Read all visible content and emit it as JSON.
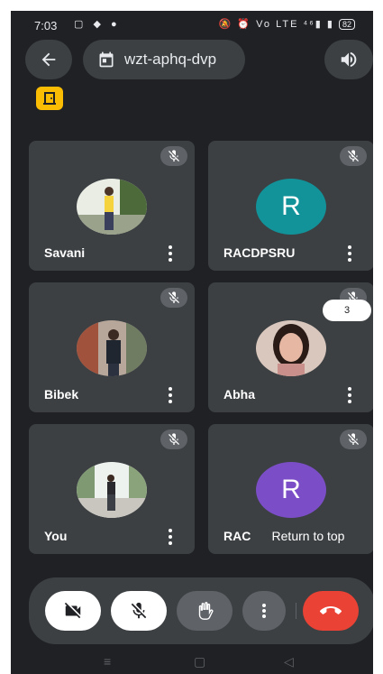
{
  "status_bar": {
    "time": "7:03",
    "left_icons": "▢ ◆ ●",
    "right_icons": "🔕 ⏰ Vo LTE ⁴⁶▮ ▮",
    "battery": "82"
  },
  "header": {
    "back_icon": "arrow-back-icon",
    "meeting_code": "wzt-aphq-dvp",
    "calendar_icon": "calendar-icon",
    "speaker_icon": "speaker-icon",
    "host_badge_icon": "door-icon",
    "colors": {
      "host_badge": "#fbbc04"
    }
  },
  "participants": [
    {
      "name": "Savani",
      "avatar": "photo",
      "muted": true
    },
    {
      "name": "RACDPSRU",
      "avatar": "letter",
      "letter": "R",
      "color": "#12939a",
      "muted": true
    },
    {
      "name": "Bibek",
      "avatar": "photo",
      "muted": true
    },
    {
      "name": "Abha",
      "avatar": "photo",
      "muted": true
    },
    {
      "name": "You",
      "avatar": "photo",
      "muted": true
    },
    {
      "name": "RAC",
      "avatar": "letter",
      "letter": "R",
      "color": "#7b4ec7",
      "muted": true
    }
  ],
  "overlay": {
    "count_badge": "3",
    "return_to_top": "Return to top"
  },
  "controls": {
    "camera_icon": "video-off-icon",
    "mic_icon": "mic-off-icon",
    "hand_icon": "raise-hand-icon",
    "more_icon": "more-vert-icon",
    "end_call_icon": "end-call-icon",
    "colors": {
      "end_call": "#ea4335",
      "toggle_off": "#ffffff"
    }
  },
  "nav_bar": {
    "menu": "≡",
    "home": "▢",
    "back": "◁"
  }
}
